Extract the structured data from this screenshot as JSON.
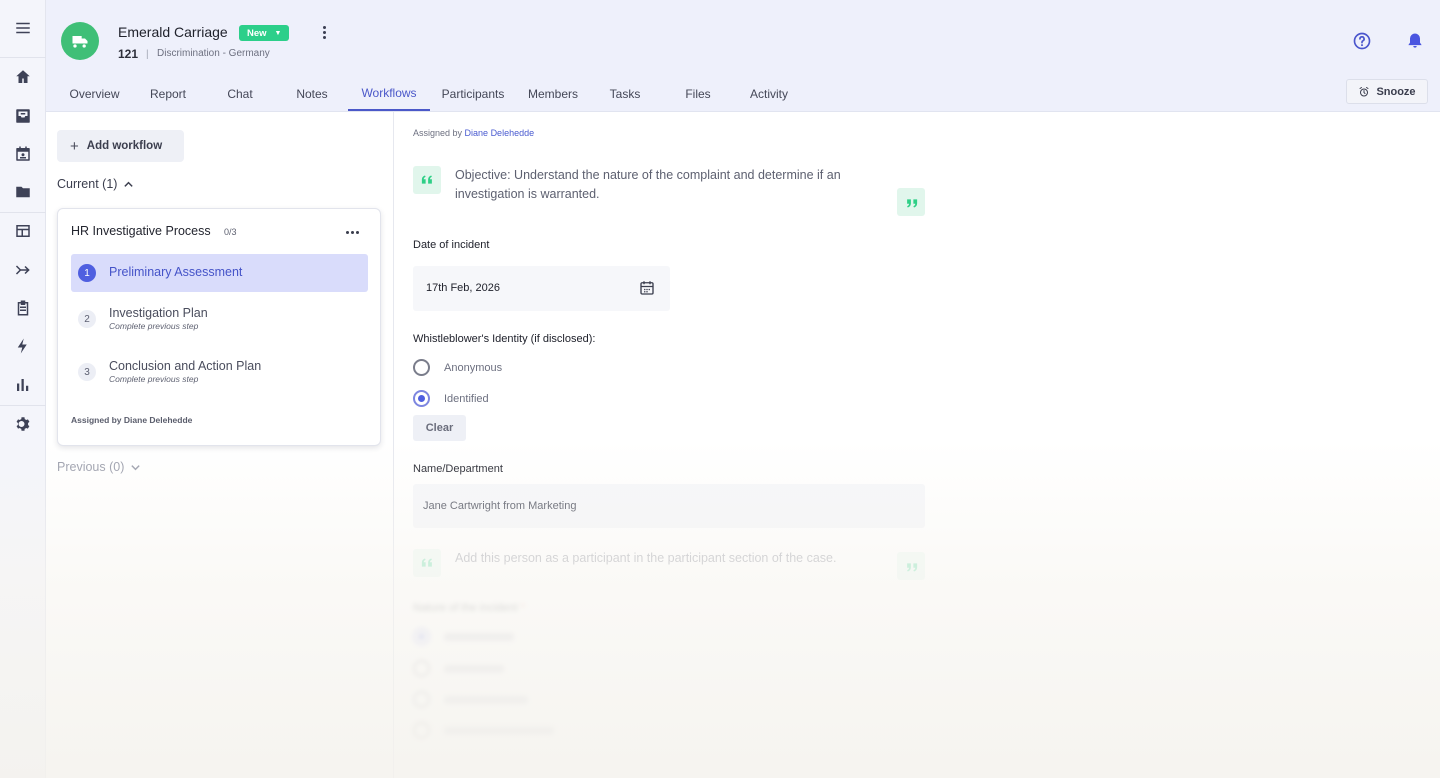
{
  "header": {
    "case_title": "Emerald Carriage",
    "status": "New",
    "case_number": "121",
    "separator": "|",
    "case_subtitle": "Discrimination - Germany",
    "snooze_label": "Snooze"
  },
  "tabs": [
    {
      "label": "Overview"
    },
    {
      "label": "Report"
    },
    {
      "label": "Chat"
    },
    {
      "label": "Notes"
    },
    {
      "label": "Workflows",
      "active": true
    },
    {
      "label": "Participants"
    },
    {
      "label": "Members"
    },
    {
      "label": "Tasks"
    },
    {
      "label": "Files"
    },
    {
      "label": "Activity"
    }
  ],
  "workflows": {
    "add_label": "Add workflow",
    "current_label": "Current (1)",
    "previous_label": "Previous (0)",
    "card": {
      "title": "HR Investigative Process",
      "progress": "0/3",
      "steps": [
        {
          "number": "1",
          "label": "Preliminary Assessment",
          "sub": ""
        },
        {
          "number": "2",
          "label": "Investigation Plan",
          "sub": "Complete previous step"
        },
        {
          "number": "3",
          "label": "Conclusion and Action Plan",
          "sub": "Complete previous step"
        }
      ],
      "assigned": "Assigned by Diane Delehedde"
    }
  },
  "form": {
    "assigned_prefix": "Assigned by",
    "assigned_name": "Diane Delehedde",
    "objective": "Objective: Understand the nature of the complaint and determine if an investigation is warranted.",
    "date_label": "Date of incident",
    "date_value": "17th Feb, 2026",
    "identity_label": "Whistleblower's Identity (if disclosed):",
    "identity_options": [
      {
        "label": "Anonymous",
        "checked": false
      },
      {
        "label": "Identified",
        "checked": true
      }
    ],
    "clear_label": "Clear",
    "name_label": "Name/Department",
    "name_value": "Jane Cartwright from Marketing",
    "participant_note": "Add this person as a participant in the participant section of the case.",
    "nature_label": "Nature of the incident",
    "required_mark": "*"
  },
  "colors": {
    "accent": "#4f5fe0",
    "status_green": "#2ccf8a",
    "avatar_green": "#3fbf77",
    "quote_green": "#2ecf86"
  },
  "icons": {
    "rail": [
      "menu-icon",
      "home-icon",
      "inbox-icon",
      "calendar-icon",
      "folder-icon",
      "table-icon",
      "merge-icon",
      "clipboard-icon",
      "bolt-icon",
      "bar-chart-icon",
      "gear-icon"
    ]
  }
}
